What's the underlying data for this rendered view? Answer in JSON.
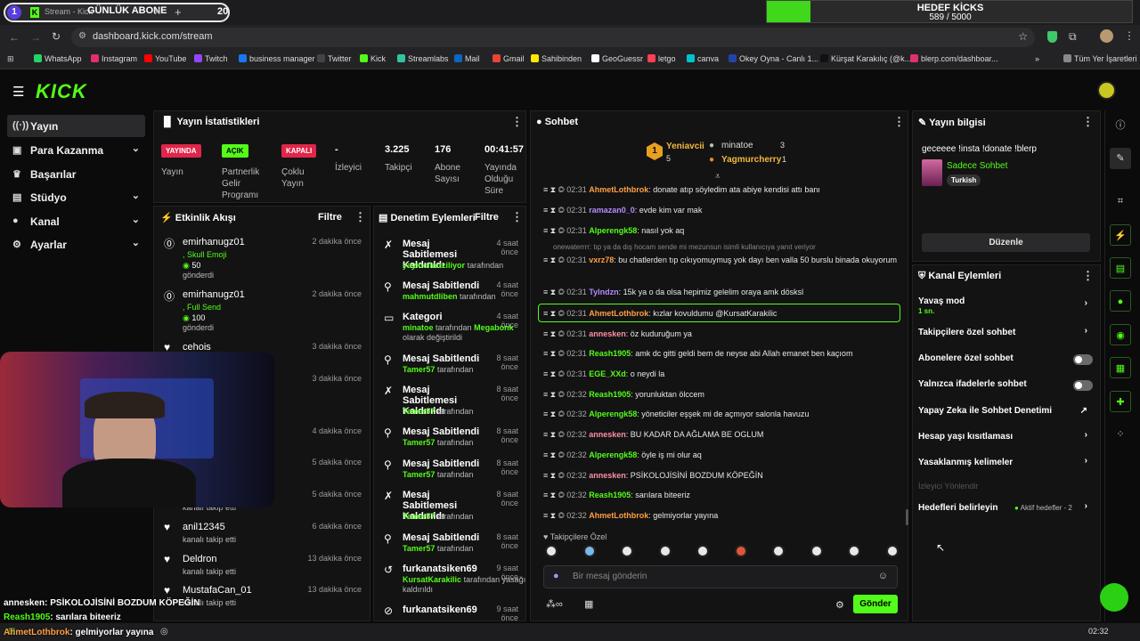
{
  "browser": {
    "tab_number": "1",
    "tab_title": "Stream - Kick",
    "tab_overlay_text": "GÜNLÜK ABONE",
    "tab_overlay_count": "20",
    "url": "dashboard.kick.com/stream",
    "goal_title": "HEDEF KİCKS",
    "goal_value": "589 / 5000",
    "goal_progress": 0.118,
    "bookmarks": [
      {
        "label": "WhatsApp",
        "color": "#25d366"
      },
      {
        "label": "Instagram",
        "color": "#e1306c"
      },
      {
        "label": "YouTube",
        "color": "#ff0000"
      },
      {
        "label": "Twitch",
        "color": "#9146ff"
      },
      {
        "label": "business manager",
        "color": "#1877f2"
      },
      {
        "label": "Twitter",
        "color": "#444"
      },
      {
        "label": "Kick",
        "color": "#53fc18"
      },
      {
        "label": "Streamlabs",
        "color": "#31c3a2"
      },
      {
        "label": "Mail",
        "color": "#0a66c2"
      },
      {
        "label": "Gmail",
        "color": "#ea4335"
      },
      {
        "label": "Sahibinden",
        "color": "#ffe800"
      },
      {
        "label": "GeoGuessr",
        "color": "#ffffff"
      },
      {
        "label": "letgo",
        "color": "#ff3f55"
      },
      {
        "label": "canva",
        "color": "#00c4cc"
      },
      {
        "label": "Okey Oyna - Canlı 1...",
        "color": "#2244aa"
      },
      {
        "label": "Kürşat Karakılıç (@k...",
        "color": "#111"
      },
      {
        "label": "blerp.com/dashboar...",
        "color": "#e03070"
      }
    ],
    "all_bookmarks": "Tüm Yer İşaretleri"
  },
  "nav": {
    "logo": "KICK",
    "items": [
      {
        "label": "Yayın"
      },
      {
        "label": "Para Kazanma"
      },
      {
        "label": "Başarılar"
      },
      {
        "label": "Stüdyo"
      },
      {
        "label": "Kanal"
      },
      {
        "label": "Ayarlar"
      }
    ]
  },
  "stats": {
    "title": "Yayın İstatistikleri",
    "live_badge": "YAYINDA",
    "live_label": "Yayın",
    "open_badge": "AÇIK",
    "open_label": "Partnerlik Gelir Programı",
    "closed_badge": "KAPALI",
    "closed_label": "Çoklu Yayın",
    "viewers_value": "-",
    "viewers_label": "İzleyici",
    "followers_value": "3.225",
    "followers_label": "Takipçi",
    "subs_value": "176",
    "subs_label": "Abone Sayısı",
    "uptime_value": "00:41:57",
    "uptime_label": "Yayında Olduğu Süre"
  },
  "activity": {
    "title": "Etkinlik Akışı",
    "filter": "Filtre",
    "events": [
      {
        "name": "emirhanugz01",
        "time": "2 dakika önce",
        "l1": ", Skull Emoji",
        "l2": "50",
        "l3": "gönderdi"
      },
      {
        "name": "emirhanugz01",
        "time": "2 dakika önce",
        "l1": ", Full Send",
        "l2": "100",
        "l3": "gönderdi"
      },
      {
        "name": "cehois",
        "time": "3 dakika önce"
      },
      {
        "name": "",
        "time": "3 dakika önce"
      },
      {
        "name": "",
        "time": "4 dakika önce"
      },
      {
        "name": "",
        "time": "5 dakika önce"
      },
      {
        "name": "",
        "time": "5 dakika önce",
        "l2": "kanalı takip etti"
      },
      {
        "name": "anil12345",
        "time": "6 dakika önce",
        "l2": "kanalı takip etti"
      },
      {
        "name": "Deldron",
        "time": "13 dakika önce",
        "l2": "kanalı takip etti"
      },
      {
        "name": "MustafaCan_01",
        "time": "13 dakika önce",
        "l2": "kanalı takip etti"
      }
    ]
  },
  "moderation": {
    "title": "Denetim Eylemleri",
    "filter": "Filtre",
    "items": [
      {
        "title": "Mesaj Sabitlemesi Kaldırıldı",
        "time": "4 saat önce",
        "user": "yayincilariziliyor",
        "suffix": "tarafından"
      },
      {
        "title": "Mesaj Sabitlendi",
        "time": "4 saat önce",
        "user": "mahmutdliben",
        "suffix": "tarafından"
      },
      {
        "title": "Kategori",
        "time": "4 saat önce",
        "user": "minatoe",
        "mid": "tarafından",
        "user2": "Megabonk",
        "suffix": "olarak değiştirildi"
      },
      {
        "title": "Mesaj Sabitlendi",
        "time": "8 saat önce",
        "user": "Tamer57",
        "suffix": "tarafından"
      },
      {
        "title": "Mesaj Sabitlemesi Kaldırıldı",
        "time": "8 saat önce",
        "user": "Tamer57",
        "suffix": "tarafından"
      },
      {
        "title": "Mesaj Sabitlendi",
        "time": "8 saat önce",
        "user": "Tamer57",
        "suffix": "tarafından"
      },
      {
        "title": "Mesaj Sabitlendi",
        "time": "8 saat önce",
        "user": "Tamer57",
        "suffix": "tarafından"
      },
      {
        "title": "Mesaj Sabitlemesi Kaldırıldı",
        "time": "8 saat önce",
        "user": "Tamer57",
        "suffix": "tarafından"
      },
      {
        "title": "Mesaj Sabitlendi",
        "time": "8 saat önce",
        "user": "Tamer57",
        "suffix": "tarafından"
      },
      {
        "title": "furkanatsiken69",
        "time": "9 saat önce",
        "user": "KursatKarakilic",
        "suffix": "tarafından yasağı kaldırıldı"
      },
      {
        "title": "furkanatsiken69",
        "time": "9 saat önce"
      }
    ]
  },
  "chat": {
    "title": "Sohbet",
    "top_gifters": [
      {
        "name": "Yeniavcii",
        "count": "5",
        "rank": "1"
      },
      {
        "name": "minatoe",
        "count": "3"
      },
      {
        "name": "Yagmurcherry",
        "count": "1"
      }
    ],
    "reply_hint": "onewaterrrr: tıp ya da dış hocam sende mi mezunsun isimli kullanıcıya yanıt veriyor",
    "messages": [
      {
        "time": "02:31",
        "user": "AhmetLothbrok",
        "color": "#ff9f43",
        "text": ": donate atıp söyledim ata abiye kendisi attı banı"
      },
      {
        "time": "02:31",
        "user": "ramazan0_0",
        "color": "#b48cff",
        "text": ": evde kim var mak"
      },
      {
        "time": "02:31",
        "user": "Alperengk58",
        "color": "#53fc18",
        "text": ": nasıl yok aq"
      },
      {
        "time": "02:31",
        "user": "vxrz78",
        "color": "#ff9f43",
        "text": ": bu chatlerden tıp cıkıyomuymuş yok dayı ben valla 50 burslu binada okuyorum"
      },
      {
        "time": "02:31",
        "user": "Tylndzn",
        "color": "#b48cff",
        "text": ": 15k ya o da olsa hepimiz gelelim oraya amk dösksl"
      },
      {
        "time": "02:31",
        "user": "AhmetLothbrok",
        "color": "#ff9f43",
        "text": ": kızlar kovuldumu @KursatKarakilic"
      },
      {
        "time": "02:31",
        "user": "annesken",
        "color": "#ff8fa0",
        "text": ": öz kuduruğum ya"
      },
      {
        "time": "02:31",
        "user": "Reash1905",
        "color": "#53fc18",
        "text": ": amk dc gitti geldi bem de neyse abi Allah emanet ben kaçıom"
      },
      {
        "time": "02:31",
        "user": "EGE_XXd",
        "color": "#53fc18",
        "text": ": o neydi la"
      },
      {
        "time": "02:32",
        "user": "Reash1905",
        "color": "#53fc18",
        "text": ": yorunluktan ölccem"
      },
      {
        "time": "02:32",
        "user": "Alperengk58",
        "color": "#53fc18",
        "text": ": yöneticiler eşşek mi de açmıyor salonla havuzu"
      },
      {
        "time": "02:32",
        "user": "annesken",
        "color": "#ff8fa0",
        "text": ": BU KADAR DA AĞLAMA BE OGLUM"
      },
      {
        "time": "02:32",
        "user": "Alperengk58",
        "color": "#53fc18",
        "text": ": öyle iş mi olur aq"
      },
      {
        "time": "02:32",
        "user": "annesken",
        "color": "#ff8fa0",
        "text": ": PSİKOLOJİSİNİ BOZDUM KÖPEĞİN"
      },
      {
        "time": "02:32",
        "user": "Reash1905",
        "color": "#53fc18",
        "text": ": sarılara biteeriz"
      },
      {
        "time": "02:32",
        "user": "AhmetLothbrok",
        "color": "#ff9f43",
        "text": ": gelmiyorlar yayına"
      }
    ],
    "followers_label": "Takipçilere Özel",
    "input_placeholder": "Bir mesaj gönderin",
    "send": "Gönder"
  },
  "stream_info": {
    "title": "Yayın bilgisi",
    "stream_title": "geceeee !insta !donate !blerp",
    "category": "Sadece Sohbet",
    "tag": "Turkish",
    "edit": "Düzenle"
  },
  "channel_actions": {
    "title": "Kanal Eylemleri",
    "slow_mode": "Yavaş mod",
    "slow_value": "1 sn.",
    "followers_only": "Takipçilere özel sohbet",
    "subs_only": "Abonelere özel sohbet",
    "emotes_only": "Yalnızca ifadelerle sohbet",
    "ai_mod": "Yapay Zeka ile Sohbet Denetimi",
    "age": "Hesap yaşı kısıtlaması",
    "banned": "Yasaklanmış kelimeler",
    "viewer_redirect": "İzleyici Yönlendir",
    "goals": "Hedefleri belirleyin",
    "goals_status": "Aktif hedefler - 2"
  },
  "overlay_chat": [
    {
      "user": "annesken",
      "text": ": PSİKOLOJİSİNİ BOZDUM KÖPEĞİN",
      "color": "#ffffff"
    },
    {
      "user": "Reash1905",
      "text": ": sarılara biteeriz",
      "color": "#53fc18"
    },
    {
      "user": "AhmetLothbrok",
      "text": ": gelmiyorlar yayına",
      "color": "#ff9f43"
    }
  ],
  "taskbar": {
    "time": "02:32"
  }
}
